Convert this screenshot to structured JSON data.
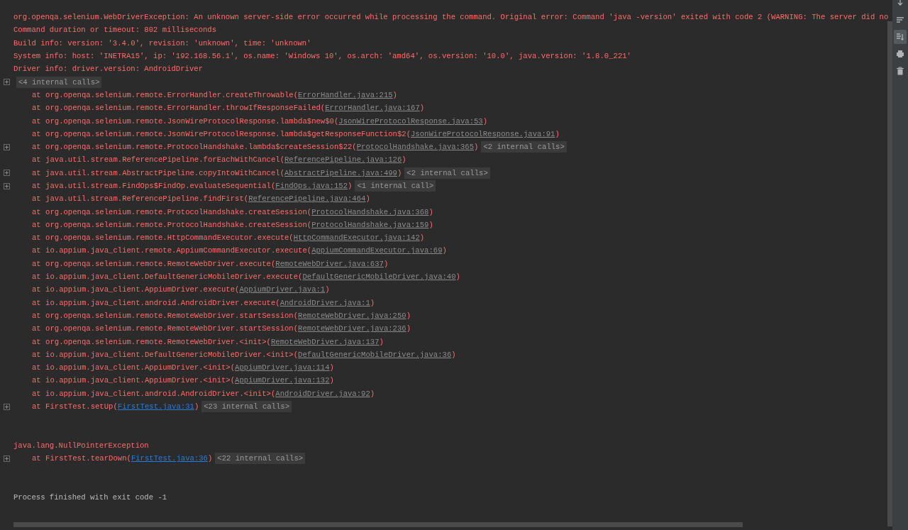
{
  "console": {
    "lines": [
      {
        "kind": "error",
        "text": "org.openqa.selenium.WebDriverException: An unknown server-side error occurred while processing the command. Original error: Command 'java -version' exited with code 2 (WARNING: The server did no"
      },
      {
        "kind": "error",
        "text": "Command duration or timeout: 802 milliseconds"
      },
      {
        "kind": "error",
        "text": "Build info: version: '3.4.0', revision: 'unknown', time: 'unknown'"
      },
      {
        "kind": "error",
        "text": "System info: host: 'INETRA15', ip: '192.168.56.1', os.name: 'Windows 10', os.arch: 'amd64', os.version: '10.0', java.version: '1.8.0_221'"
      },
      {
        "kind": "error",
        "text": "Driver info: driver.version: AndroidDriver"
      },
      {
        "kind": "folded",
        "foldable": true,
        "badge": "<4 internal calls>"
      },
      {
        "kind": "frame",
        "foldable": false,
        "text": "at org.openqa.selenium.remote.ErrorHandler.createThrowable(",
        "link": {
          "text": "ErrorHandler.java:215",
          "color": "#8c8c8c"
        },
        "close": ")"
      },
      {
        "kind": "frame",
        "foldable": false,
        "text": "at org.openqa.selenium.remote.ErrorHandler.throwIfResponseFailed(",
        "link": {
          "text": "ErrorHandler.java:167",
          "color": "#8c8c8c"
        },
        "close": ")"
      },
      {
        "kind": "frame",
        "foldable": false,
        "text": "at org.openqa.selenium.remote.JsonWireProtocolResponse.lambda$new$0(",
        "link": {
          "text": "JsonWireProtocolResponse.java:53",
          "color": "#8c8c8c"
        },
        "close": ")"
      },
      {
        "kind": "frame",
        "foldable": false,
        "text": "at org.openqa.selenium.remote.JsonWireProtocolResponse.lambda$getResponseFunction$2(",
        "link": {
          "text": "JsonWireProtocolResponse.java:91",
          "color": "#8c8c8c"
        },
        "close": ")"
      },
      {
        "kind": "frame",
        "foldable": true,
        "text": "at org.openqa.selenium.remote.ProtocolHandshake.lambda$createSession$22(",
        "link": {
          "text": "ProtocolHandshake.java:365",
          "color": "#8c8c8c"
        },
        "close": ")",
        "badge": "<2 internal calls>"
      },
      {
        "kind": "frame",
        "foldable": false,
        "text": "at java.util.stream.ReferencePipeline.forEachWithCancel(",
        "link": {
          "text": "ReferencePipeline.java:126",
          "color": "#8c8c8c"
        },
        "close": ")"
      },
      {
        "kind": "frame",
        "foldable": true,
        "text": "at java.util.stream.AbstractPipeline.copyIntoWithCancel(",
        "link": {
          "text": "AbstractPipeline.java:499",
          "color": "#8c8c8c"
        },
        "close": ")",
        "badge": "<2 internal calls>"
      },
      {
        "kind": "frame",
        "foldable": true,
        "text": "at java.util.stream.FindOps$FindOp.evaluateSequential(",
        "link": {
          "text": "FindOps.java:152",
          "color": "#8c8c8c"
        },
        "close": ")",
        "badge": "<1 internal call>"
      },
      {
        "kind": "frame",
        "foldable": false,
        "text": "at java.util.stream.ReferencePipeline.findFirst(",
        "link": {
          "text": "ReferencePipeline.java:464",
          "color": "#8c8c8c"
        },
        "close": ")"
      },
      {
        "kind": "frame",
        "foldable": false,
        "text": "at org.openqa.selenium.remote.ProtocolHandshake.createSession(",
        "link": {
          "text": "ProtocolHandshake.java:368",
          "color": "#8c8c8c"
        },
        "close": ")"
      },
      {
        "kind": "frame",
        "foldable": false,
        "text": "at org.openqa.selenium.remote.ProtocolHandshake.createSession(",
        "link": {
          "text": "ProtocolHandshake.java:159",
          "color": "#8c8c8c"
        },
        "close": ")"
      },
      {
        "kind": "frame",
        "foldable": false,
        "text": "at org.openqa.selenium.remote.HttpCommandExecutor.execute(",
        "link": {
          "text": "HttpCommandExecutor.java:142",
          "color": "#8c8c8c"
        },
        "close": ")"
      },
      {
        "kind": "frame",
        "foldable": false,
        "text": "at io.appium.java_client.remote.AppiumCommandExecutor.execute(",
        "link": {
          "text": "AppiumCommandExecutor.java:69",
          "color": "#8c8c8c"
        },
        "close": ")"
      },
      {
        "kind": "frame",
        "foldable": false,
        "text": "at org.openqa.selenium.remote.RemoteWebDriver.execute(",
        "link": {
          "text": "RemoteWebDriver.java:637",
          "color": "#8c8c8c"
        },
        "close": ")"
      },
      {
        "kind": "frame",
        "foldable": false,
        "text": "at io.appium.java_client.DefaultGenericMobileDriver.execute(",
        "link": {
          "text": "DefaultGenericMobileDriver.java:40",
          "color": "#8c8c8c"
        },
        "close": ")"
      },
      {
        "kind": "frame",
        "foldable": false,
        "text": "at io.appium.java_client.AppiumDriver.execute(",
        "link": {
          "text": "AppiumDriver.java:1",
          "color": "#8c8c8c"
        },
        "close": ")"
      },
      {
        "kind": "frame",
        "foldable": false,
        "text": "at io.appium.java_client.android.AndroidDriver.execute(",
        "link": {
          "text": "AndroidDriver.java:1",
          "color": "#8c8c8c"
        },
        "close": ")"
      },
      {
        "kind": "frame",
        "foldable": false,
        "text": "at org.openqa.selenium.remote.RemoteWebDriver.startSession(",
        "link": {
          "text": "RemoteWebDriver.java:250",
          "color": "#8c8c8c"
        },
        "close": ")"
      },
      {
        "kind": "frame",
        "foldable": false,
        "text": "at org.openqa.selenium.remote.RemoteWebDriver.startSession(",
        "link": {
          "text": "RemoteWebDriver.java:236",
          "color": "#8c8c8c"
        },
        "close": ")"
      },
      {
        "kind": "frame",
        "foldable": false,
        "text": "at org.openqa.selenium.remote.RemoteWebDriver.<init>(",
        "link": {
          "text": "RemoteWebDriver.java:137",
          "color": "#8c8c8c"
        },
        "close": ")"
      },
      {
        "kind": "frame",
        "foldable": false,
        "text": "at io.appium.java_client.DefaultGenericMobileDriver.<init>(",
        "link": {
          "text": "DefaultGenericMobileDriver.java:36",
          "color": "#8c8c8c"
        },
        "close": ")"
      },
      {
        "kind": "frame",
        "foldable": false,
        "text": "at io.appium.java_client.AppiumDriver.<init>(",
        "link": {
          "text": "AppiumDriver.java:114",
          "color": "#8c8c8c"
        },
        "close": ")"
      },
      {
        "kind": "frame",
        "foldable": false,
        "text": "at io.appium.java_client.AppiumDriver.<init>(",
        "link": {
          "text": "AppiumDriver.java:132",
          "color": "#8c8c8c"
        },
        "close": ")"
      },
      {
        "kind": "frame",
        "foldable": false,
        "text": "at io.appium.java_client.android.AndroidDriver.<init>(",
        "link": {
          "text": "AndroidDriver.java:92",
          "color": "#8c8c8c"
        },
        "close": ")"
      },
      {
        "kind": "frame",
        "foldable": true,
        "text": "at FirstTest.setUp(",
        "link": {
          "text": "FirstTest.java:31",
          "color": "#287bde"
        },
        "close": ")",
        "badge": "<23 internal calls>"
      },
      {
        "kind": "blank"
      },
      {
        "kind": "blank"
      },
      {
        "kind": "error",
        "text": "java.lang.NullPointerException"
      },
      {
        "kind": "frame",
        "foldable": true,
        "text": "at FirstTest.tearDown(",
        "link": {
          "text": "FirstTest.java:36",
          "color": "#287bde"
        },
        "close": ")",
        "badge": "<22 internal calls>"
      },
      {
        "kind": "blank"
      },
      {
        "kind": "blank"
      },
      {
        "kind": "info",
        "text": "Process finished with exit code -1"
      }
    ]
  },
  "toolbar": [
    {
      "kind": "down",
      "selected": false
    },
    {
      "kind": "wrap",
      "selected": false
    },
    {
      "kind": "scroll",
      "selected": true
    },
    {
      "kind": "print",
      "selected": false
    },
    {
      "kind": "trash",
      "selected": false
    }
  ]
}
